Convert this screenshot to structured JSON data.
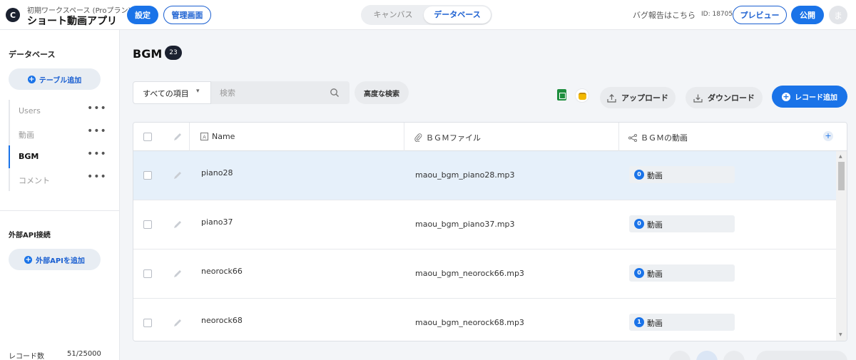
{
  "header": {
    "workspace": "初期ワークスペース (Proプラン)",
    "app_name": "ショート動画アプリ",
    "settings_label": "設定",
    "admin_label": "管理画面",
    "mode_tabs": [
      {
        "label": "キャンバス",
        "active": false
      },
      {
        "label": "データベース",
        "active": true
      }
    ],
    "bug_report": "バグ報告はこちら",
    "app_id": "ID: 18705",
    "preview_label": "プレビュー",
    "publish_label": "公開",
    "avatar_initial": "ま"
  },
  "sidebar": {
    "db_title": "データベース",
    "add_table_label": "テーブル追加",
    "tables": [
      {
        "label": "Users",
        "active": false
      },
      {
        "label": "動画",
        "active": false
      },
      {
        "label": "BGM",
        "active": true
      },
      {
        "label": "コメント",
        "active": false
      }
    ],
    "more_glyph": "•••",
    "api_title": "外部API接続",
    "add_api_label": "外部APIを追加",
    "record_count_label": "レコード数",
    "record_count_value": "51/25000"
  },
  "main": {
    "title": "BGM",
    "count": "23",
    "filter_label": "すべての項目",
    "search_placeholder": "検索",
    "advanced_search_label": "高度な検索",
    "upload_label": "アップロード",
    "download_label": "ダウンロード",
    "add_record_label": "レコード追加",
    "columns": [
      {
        "label": "Name"
      },
      {
        "label": "ＢＧＭファイル"
      },
      {
        "label": "ＢＧＭの動画"
      }
    ],
    "rows": [
      {
        "name": "piano28",
        "file": "maou_bgm_piano28.mp3",
        "rel_count": "0",
        "rel_label": "動画",
        "selected": true
      },
      {
        "name": "piano37",
        "file": "maou_bgm_piano37.mp3",
        "rel_count": "0",
        "rel_label": "動画",
        "selected": false
      },
      {
        "name": "neorock66",
        "file": "maou_bgm_neorock66.mp3",
        "rel_count": "0",
        "rel_label": "動画",
        "selected": false
      },
      {
        "name": "neorock68",
        "file": "maou_bgm_neorock68.mp3",
        "rel_count": "1",
        "rel_label": "動画",
        "selected": false
      }
    ]
  },
  "colors": {
    "accent": "#1a73e8",
    "selected_row": "#e6f0fa",
    "dark_badge": "#1b2130"
  }
}
